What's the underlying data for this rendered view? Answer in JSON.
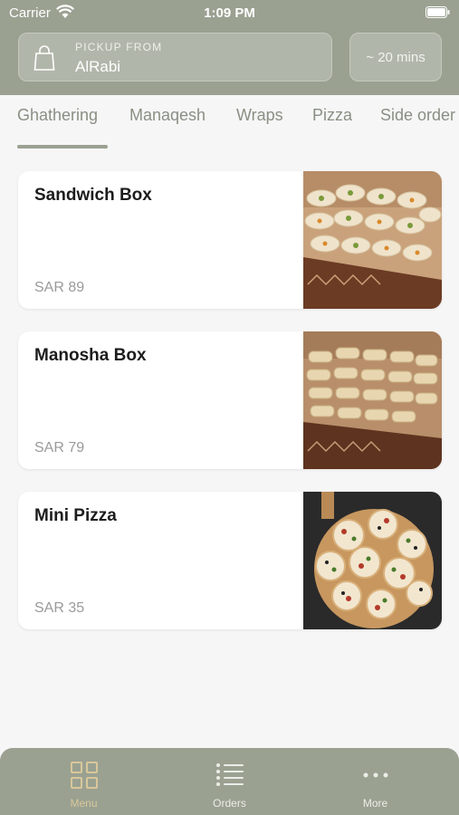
{
  "status_bar": {
    "carrier": "Carrier",
    "time": "1:09 PM"
  },
  "header": {
    "pickup_label": "PICKUP FROM",
    "store_name": "AlRabi",
    "wait_time": "~ 20 mins"
  },
  "category_tabs": [
    {
      "label": "Ghathering",
      "active": true
    },
    {
      "label": "Manaqesh"
    },
    {
      "label": "Wraps"
    },
    {
      "label": "Pizza"
    },
    {
      "label": "Side order"
    }
  ],
  "menu_items": [
    {
      "title": "Sandwich Box",
      "price": "SAR 89",
      "image": "wrap-sandwich-tray-photo"
    },
    {
      "title": "Manosha Box",
      "price": "SAR 79",
      "image": "rolled-manakish-box-photo"
    },
    {
      "title": "Mini Pizza",
      "price": "SAR 35",
      "image": "mini-pizzas-board-photo"
    }
  ],
  "tab_bar": [
    {
      "label": "Menu",
      "icon": "grid-icon",
      "active": true
    },
    {
      "label": "Orders",
      "icon": "list-icon"
    },
    {
      "label": "More",
      "icon": "more-dots-icon"
    }
  ],
  "colors": {
    "header_bg": "#9aa191",
    "active_accent": "#d8c79a",
    "background": "#f6f6f6"
  }
}
